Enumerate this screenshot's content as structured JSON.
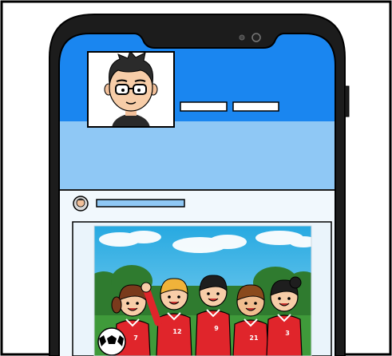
{
  "colors": {
    "page_background": "#ffffff",
    "outer_border": "#000000",
    "phone_body": "#1c1c1c",
    "screen_header_blue": "#1a86f0",
    "screen_panel_light_blue": "#8fc8f5",
    "feed_background": "#e8f3fb",
    "post_card": "#f1f8fd",
    "name_placeholder_bar": "#8fc8f5",
    "profile_action_bars": "#ffffff",
    "team_jersey_red": "#e0252b",
    "sky": "#3cb8e6",
    "grass": "#3f9a3a"
  },
  "icons": {
    "camera": "front-camera-icon",
    "avatar": "cartoon-boy-with-glasses-avatar",
    "post_avatar": "small-user-avatar-icon",
    "post_photo": "soccer-team-photo",
    "ball": "soccer-ball-icon"
  },
  "profile": {
    "action_buttons_count": 2
  },
  "post": {
    "jersey_numbers": [
      "7",
      "12",
      "9",
      "21",
      "3"
    ]
  }
}
